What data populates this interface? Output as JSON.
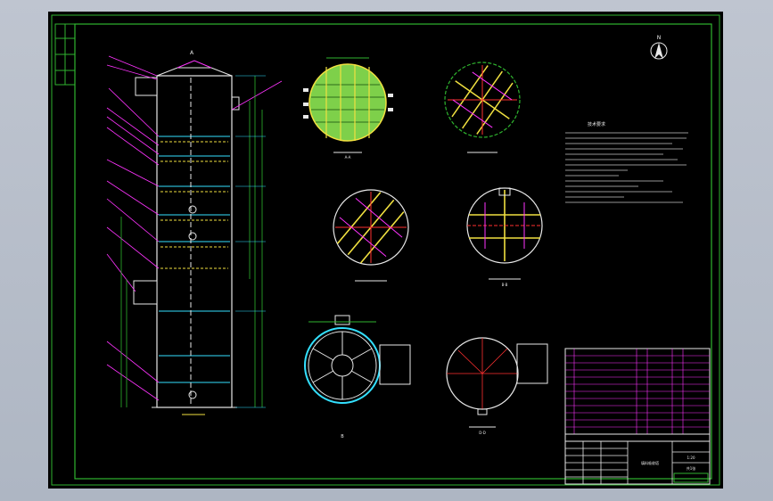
{
  "drawing": {
    "column_label": "A",
    "north_arrow_label": "N",
    "view_labels": {
      "top_left_plan": "A-A",
      "mid_right_plan": "B-B",
      "bottom_left_plan": "C-C",
      "bottom_right_plan": "D-D",
      "bottom_left_mark": "B"
    },
    "tech_requirements_title": "技术要求",
    "title_block": {
      "drawing_title": "填料吸收塔",
      "scale": "1:20",
      "sheet": "共1张"
    }
  },
  "colors": {
    "sheet_bg": "#000000",
    "frame_green": "#2fb52f",
    "white_line": "#e8e8e8",
    "magenta": "#ff33ff",
    "cyan": "#33e0ff",
    "yellow": "#f0e040",
    "red": "#ff3030",
    "grid_green": "#7ed04a"
  }
}
